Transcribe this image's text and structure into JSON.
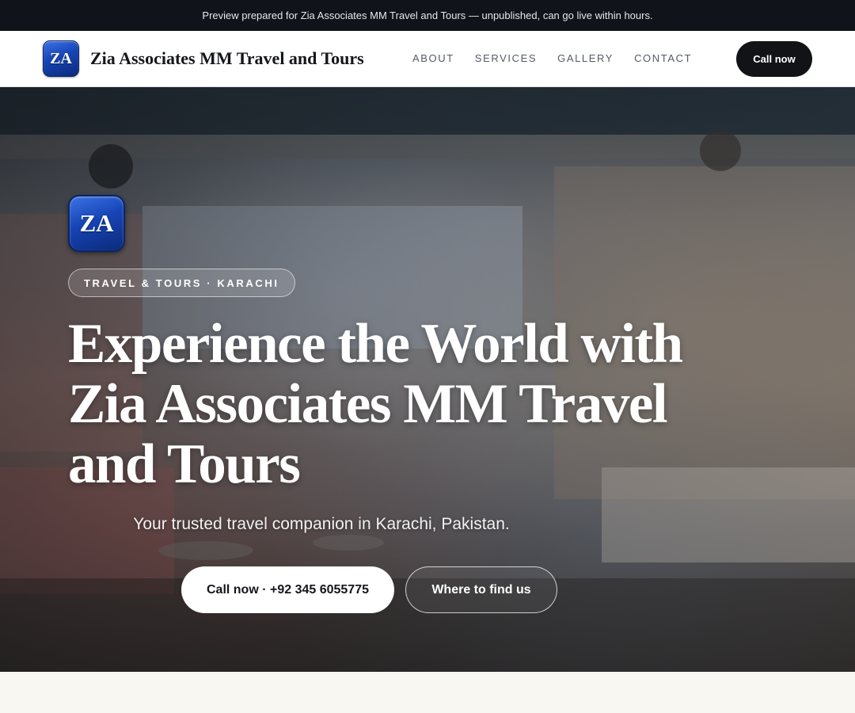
{
  "notice": {
    "text": "Preview prepared for Zia Associates MM Travel and Tours — unpublished, can go live within hours."
  },
  "header": {
    "logo_initials": "ZA",
    "brand_name": "Zia Associates MM Travel and Tours",
    "nav": [
      {
        "label": "ABOUT"
      },
      {
        "label": "SERVICES"
      },
      {
        "label": "GALLERY"
      },
      {
        "label": "CONTACT"
      }
    ],
    "call_label": "Call now"
  },
  "hero": {
    "logo_initials": "ZA",
    "tagline": "TRAVEL & TOURS · KARACHI",
    "title": "Experience the World with Zia Associates MM Travel and Tours",
    "subtitle": "Your trusted travel companion in Karachi, Pakistan.",
    "primary_button": "Call now · +92 345 6055775",
    "secondary_button": "Where to find us"
  },
  "colors": {
    "notice_bg": "#11131a",
    "brand_blue": "#1744b5",
    "cta_dark": "#111317",
    "page_bg": "#f8f7f2"
  }
}
